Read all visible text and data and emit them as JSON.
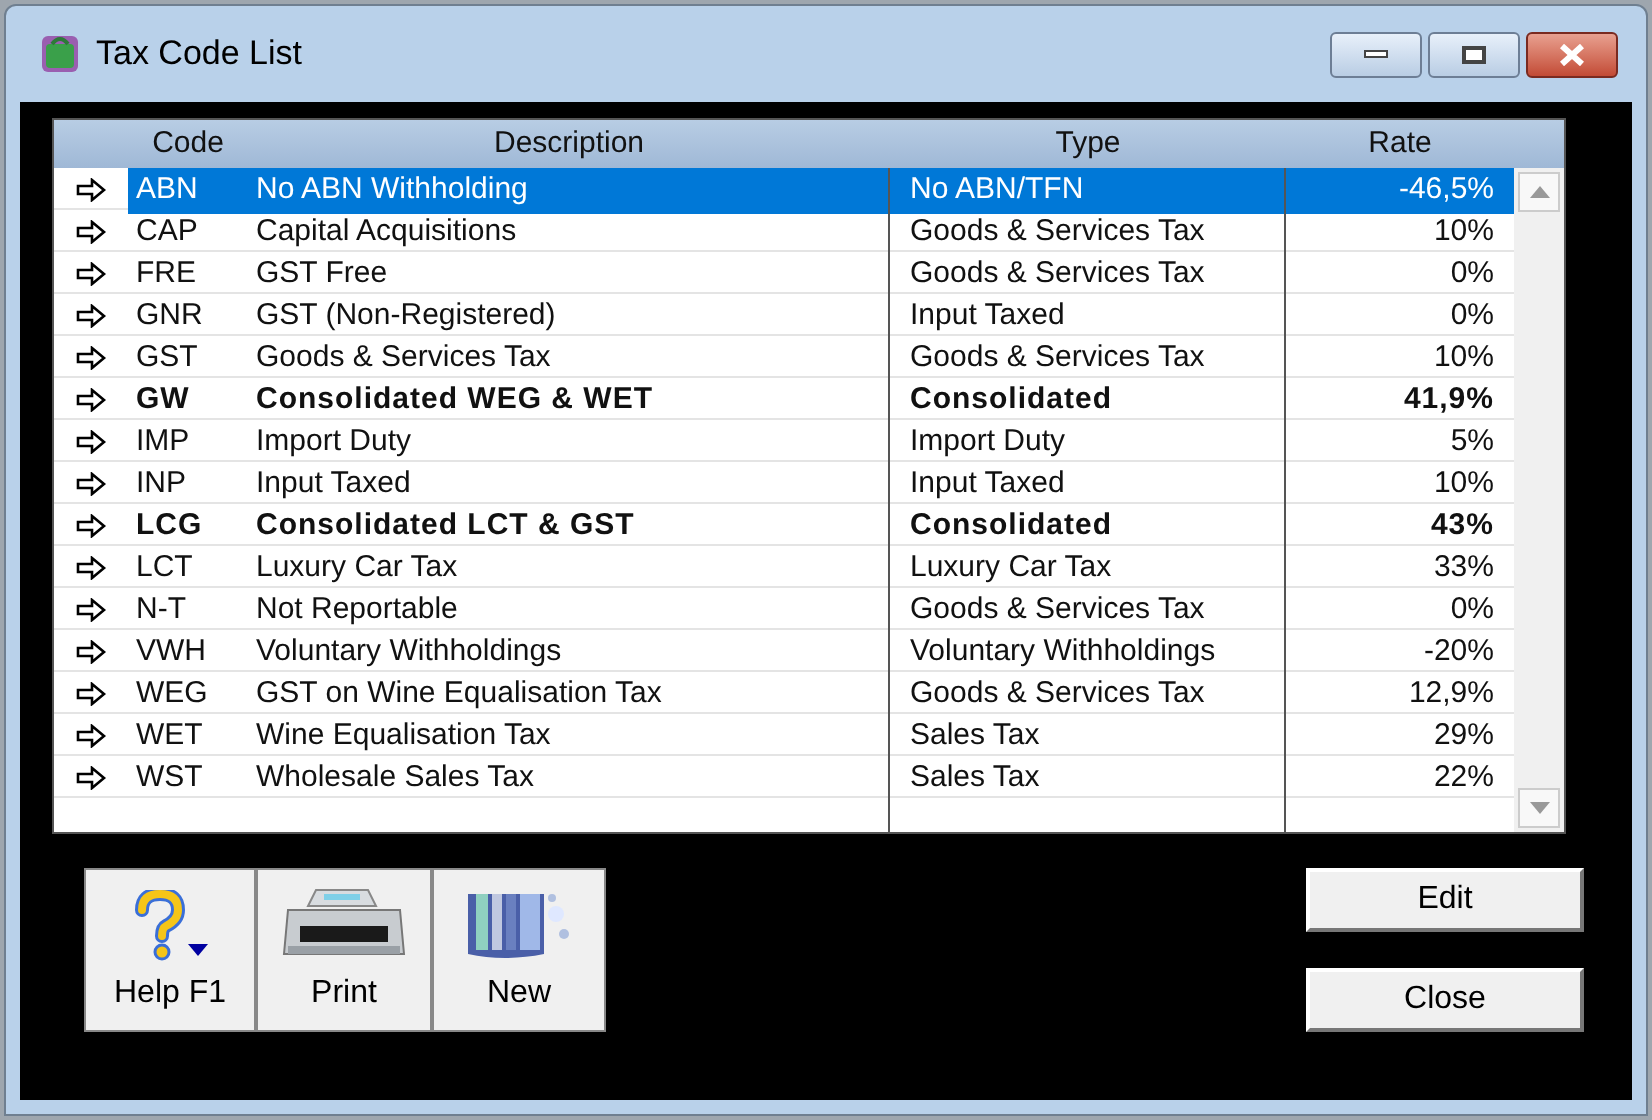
{
  "window": {
    "title": "Tax Code List"
  },
  "table": {
    "columns": [
      "Code",
      "Description",
      "Type",
      "Rate"
    ],
    "rows": [
      {
        "code": "ABN",
        "description": "No ABN Withholding",
        "type": "No ABN/TFN",
        "rate": "-46,5%",
        "bold": false,
        "selected": true
      },
      {
        "code": "CAP",
        "description": "Capital Acquisitions",
        "type": "Goods & Services Tax",
        "rate": "10%",
        "bold": false,
        "selected": false
      },
      {
        "code": "FRE",
        "description": "GST Free",
        "type": "Goods & Services Tax",
        "rate": "0%",
        "bold": false,
        "selected": false
      },
      {
        "code": "GNR",
        "description": "GST (Non-Registered)",
        "type": "Input Taxed",
        "rate": "0%",
        "bold": false,
        "selected": false
      },
      {
        "code": "GST",
        "description": "Goods & Services Tax",
        "type": "Goods & Services Tax",
        "rate": "10%",
        "bold": false,
        "selected": false
      },
      {
        "code": "GW",
        "description": "Consolidated WEG & WET",
        "type": "Consolidated",
        "rate": "41,9%",
        "bold": true,
        "selected": false
      },
      {
        "code": "IMP",
        "description": "Import Duty",
        "type": "Import Duty",
        "rate": "5%",
        "bold": false,
        "selected": false
      },
      {
        "code": "INP",
        "description": "Input Taxed",
        "type": "Input Taxed",
        "rate": "10%",
        "bold": false,
        "selected": false
      },
      {
        "code": "LCG",
        "description": "Consolidated LCT & GST",
        "type": "Consolidated",
        "rate": "43%",
        "bold": true,
        "selected": false
      },
      {
        "code": "LCT",
        "description": "Luxury Car Tax",
        "type": "Luxury Car Tax",
        "rate": "33%",
        "bold": false,
        "selected": false
      },
      {
        "code": "N-T",
        "description": "Not Reportable",
        "type": "Goods & Services Tax",
        "rate": "0%",
        "bold": false,
        "selected": false
      },
      {
        "code": "VWH",
        "description": "Voluntary Withholdings",
        "type": "Voluntary Withholdings",
        "rate": "-20%",
        "bold": false,
        "selected": false
      },
      {
        "code": "WEG",
        "description": "GST on Wine Equalisation Tax",
        "type": "Goods & Services Tax",
        "rate": "12,9%",
        "bold": false,
        "selected": false
      },
      {
        "code": "WET",
        "description": "Wine Equalisation Tax",
        "type": "Sales Tax",
        "rate": "29%",
        "bold": false,
        "selected": false
      },
      {
        "code": "WST",
        "description": "Wholesale Sales Tax",
        "type": "Sales Tax",
        "rate": "22%",
        "bold": false,
        "selected": false
      }
    ]
  },
  "toolbar": [
    {
      "kind": "help",
      "label": "Help F1"
    },
    {
      "kind": "print",
      "label": "Print"
    },
    {
      "kind": "new",
      "label": "New"
    }
  ],
  "buttons": [
    "Edit",
    "Close"
  ]
}
